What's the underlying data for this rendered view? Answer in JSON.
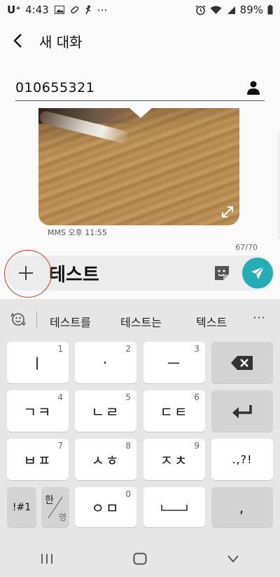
{
  "status_bar": {
    "carrier": "U⁺",
    "time": "4:43",
    "more": "⋯",
    "battery_text": "89%"
  },
  "header": {
    "title": "새 대화"
  },
  "recipient": {
    "number": "010655321"
  },
  "message": {
    "meta": "MMS 오후 11:55"
  },
  "char_counter": "67/70",
  "composer": {
    "text": "테스트"
  },
  "suggestions": {
    "items": [
      "테스트를",
      "테스트는",
      "텍스트"
    ],
    "more": "⋯"
  },
  "keyboard": {
    "row1": [
      {
        "label": "ㅣ",
        "num": "1"
      },
      {
        "label": "·",
        "num": "2"
      },
      {
        "label": "ㅡ",
        "num": "3"
      }
    ],
    "row2": [
      {
        "label": "ㄱㅋ",
        "num": "4"
      },
      {
        "label": "ㄴㄹ",
        "num": "5"
      },
      {
        "label": "ㄷㅌ",
        "num": "6"
      }
    ],
    "row3": [
      {
        "label": "ㅂㅍ",
        "num": "7"
      },
      {
        "label": "ㅅㅎ",
        "num": "8"
      },
      {
        "label": "ㅈㅊ",
        "num": "9"
      }
    ],
    "punct": ".,?!",
    "symbols": "!#1",
    "lang_top": "한",
    "lang_bottom": "영",
    "row4_key": {
      "label": "ㅇㅁ",
      "num": "0"
    },
    "comma": ","
  },
  "colors": {
    "send": "#24adb4",
    "highlight_ring": "#d0312d"
  }
}
